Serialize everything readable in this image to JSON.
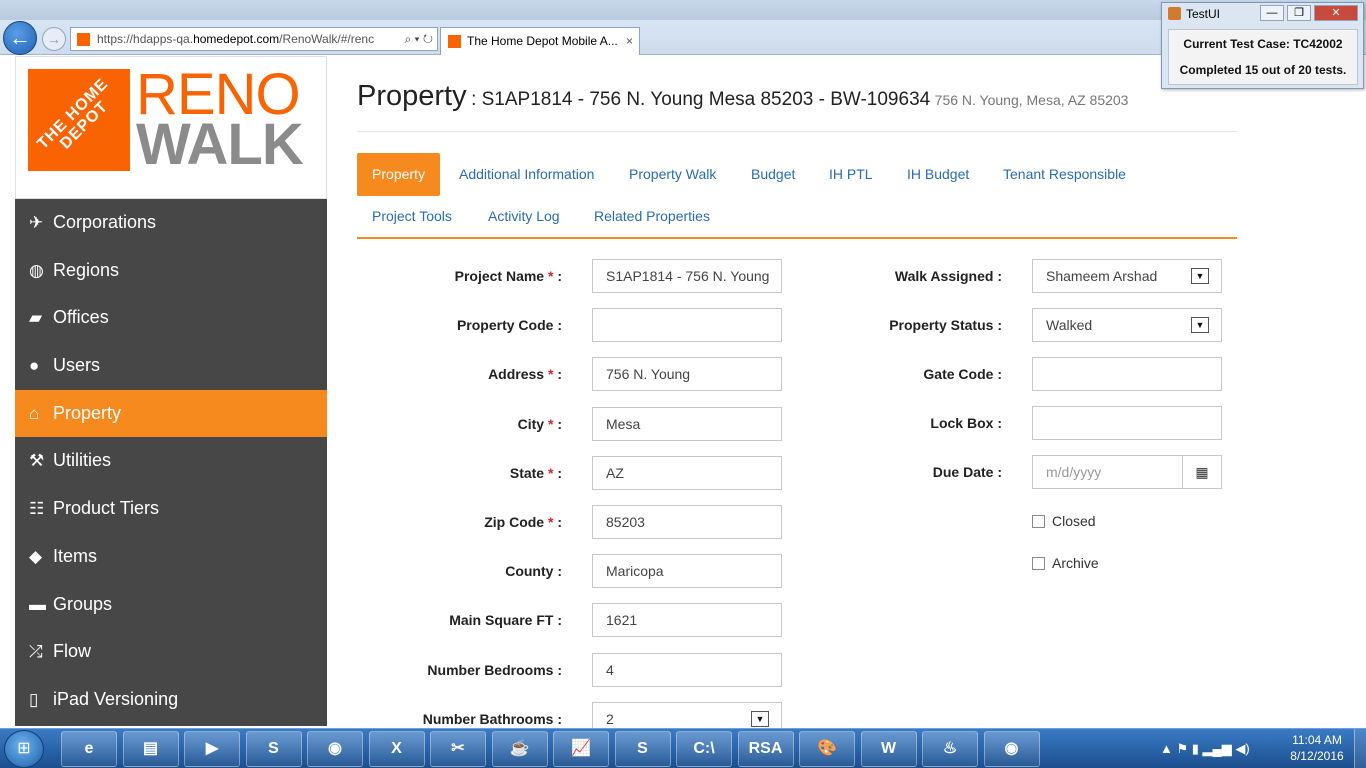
{
  "browser": {
    "url_prefix": "https://hdapps-qa.",
    "url_domain": "homedepot.com",
    "url_suffix": "/RenoWalk/#/renc",
    "url_icons": "⌕ ▾ ↻",
    "tab_title": "The Home Depot Mobile A...",
    "tab_close": "×",
    "back": "←",
    "forward": "→"
  },
  "testui": {
    "title": "TestUI",
    "minimize": "—",
    "maximize": "❐",
    "close": "✕",
    "current_case": "Current Test Case: TC42002",
    "progress": "Completed 15 out of 20 tests."
  },
  "logo": {
    "brand_text": "THE HOME DEPOT",
    "reno": "RENO",
    "walk": "WALK"
  },
  "sidebar": {
    "items": [
      {
        "label": "Corporations",
        "icon": "✈"
      },
      {
        "label": "Regions",
        "icon": "◍"
      },
      {
        "label": "Offices",
        "icon": "▰"
      },
      {
        "label": "Users",
        "icon": "●"
      },
      {
        "label": "Property",
        "icon": "⌂"
      },
      {
        "label": "Utilities",
        "icon": "⚒"
      },
      {
        "label": "Product Tiers",
        "icon": "☷"
      },
      {
        "label": "Items",
        "icon": "◆"
      },
      {
        "label": "Groups",
        "icon": "▬"
      },
      {
        "label": "Flow",
        "icon": "⤮"
      },
      {
        "label": "iPad Versioning",
        "icon": "▯"
      }
    ],
    "active": "Property"
  },
  "header": {
    "title": "Property",
    "subtitle": ": S1AP1814 - 756 N. Young Mesa 85203 - BW-109634",
    "address": "756 N. Young, Mesa, AZ 85203"
  },
  "tabs": {
    "row1": [
      "Property",
      "Additional Information",
      "Property Walk",
      "Budget",
      "IH PTL",
      "IH Budget",
      "Tenant Responsible"
    ],
    "row2": [
      "Project Tools",
      "Activity Log",
      "Related Properties"
    ]
  },
  "form": {
    "left": [
      {
        "label": "Project Name",
        "required": true,
        "value": "S1AP1814 - 756 N. Young"
      },
      {
        "label": "Property Code",
        "required": false,
        "value": ""
      },
      {
        "label": "Address",
        "required": true,
        "value": "756 N. Young"
      },
      {
        "label": "City",
        "required": true,
        "value": "Mesa"
      },
      {
        "label": "State",
        "required": true,
        "value": "AZ"
      },
      {
        "label": "Zip Code",
        "required": true,
        "value": "85203"
      },
      {
        "label": "County",
        "required": false,
        "value": "Maricopa"
      },
      {
        "label": "Main Square FT",
        "required": false,
        "value": "1621"
      },
      {
        "label": "Number Bedrooms",
        "required": false,
        "value": "4"
      },
      {
        "label": "Number Bathrooms",
        "required": false,
        "value": "2"
      }
    ],
    "right": {
      "walk_assigned_label": "Walk Assigned :",
      "walk_assigned_value": "Shameem Arshad",
      "property_status_label": "Property Status :",
      "property_status_value": "Walked",
      "gate_code_label": "Gate Code :",
      "lock_box_label": "Lock Box :",
      "due_date_label": "Due Date :",
      "due_date_placeholder": "m/d/yyyy",
      "closed_label": "Closed",
      "archive_label": "Archive"
    },
    "required_mark": "*",
    "colon": ":"
  },
  "taskbar": {
    "start_icon": "windows-start-icon",
    "apps": [
      "e",
      "▤",
      "▶",
      "S",
      "◉",
      "X",
      "✂",
      "☕",
      "📈",
      "S",
      "C:\\",
      "RSA",
      "🎨",
      "W",
      "♨",
      "◉"
    ],
    "time": "11:04 AM",
    "date": "8/12/2016"
  },
  "colors": {
    "orange": "#f68a1e",
    "sidebar": "#474747",
    "link": "#2a6cb0",
    "required": "#d9262e"
  }
}
